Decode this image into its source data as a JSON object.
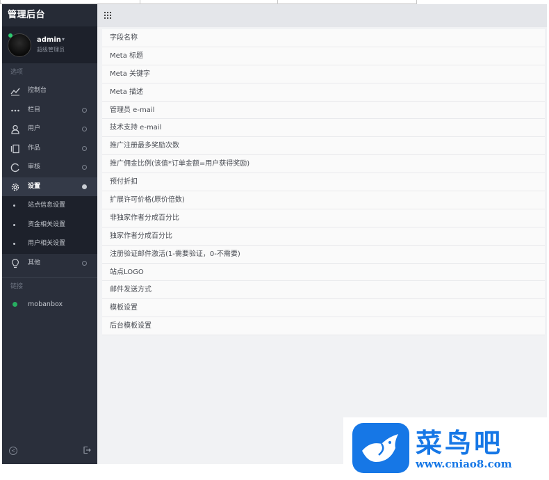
{
  "app": {
    "title": "管理后台"
  },
  "user": {
    "name": "admin",
    "caret": "▾",
    "role": "超级管理员"
  },
  "sidebar": {
    "section_options": "选项",
    "items": [
      {
        "label": "控制台",
        "icon": "chart-line-icon"
      },
      {
        "label": "栏目",
        "icon": "dots-icon"
      },
      {
        "label": "用户",
        "icon": "user-icon"
      },
      {
        "label": "作品",
        "icon": "works-icon"
      },
      {
        "label": "审核",
        "icon": "review-icon"
      },
      {
        "label": "设置",
        "icon": "gear-icon",
        "active": true
      }
    ],
    "sub_items": [
      {
        "label": "站点信息设置"
      },
      {
        "label": "资金相关设置"
      },
      {
        "label": "用户相关设置"
      }
    ],
    "other": {
      "label": "其他",
      "icon": "lightbulb-icon"
    },
    "section_links": "链接",
    "link": {
      "label": "mobanbox"
    }
  },
  "settings_rows": [
    "字段名称",
    "Meta 标题",
    "Meta 关键字",
    "Meta 描述",
    "管理员 e-mail",
    "技术支持 e-mail",
    "推广注册最多奖励次数",
    "推广佣金比例(该值*订单金额=用户获得奖励)",
    "预付折扣",
    "扩展许可价格(原价倍数)",
    "非独家作者分成百分比",
    "独家作者分成百分比",
    "注册验证邮件激活(1-需要验证，0-不需要)",
    "站点LOGO",
    "邮件发送方式",
    "模板设置",
    "后台模板设置"
  ],
  "watermark": {
    "title": "菜鸟吧",
    "url": "www.cniao8.com"
  },
  "colors": {
    "sidebar": "#2a2f3b",
    "accent": "#1677e6",
    "online": "#27ae60"
  }
}
